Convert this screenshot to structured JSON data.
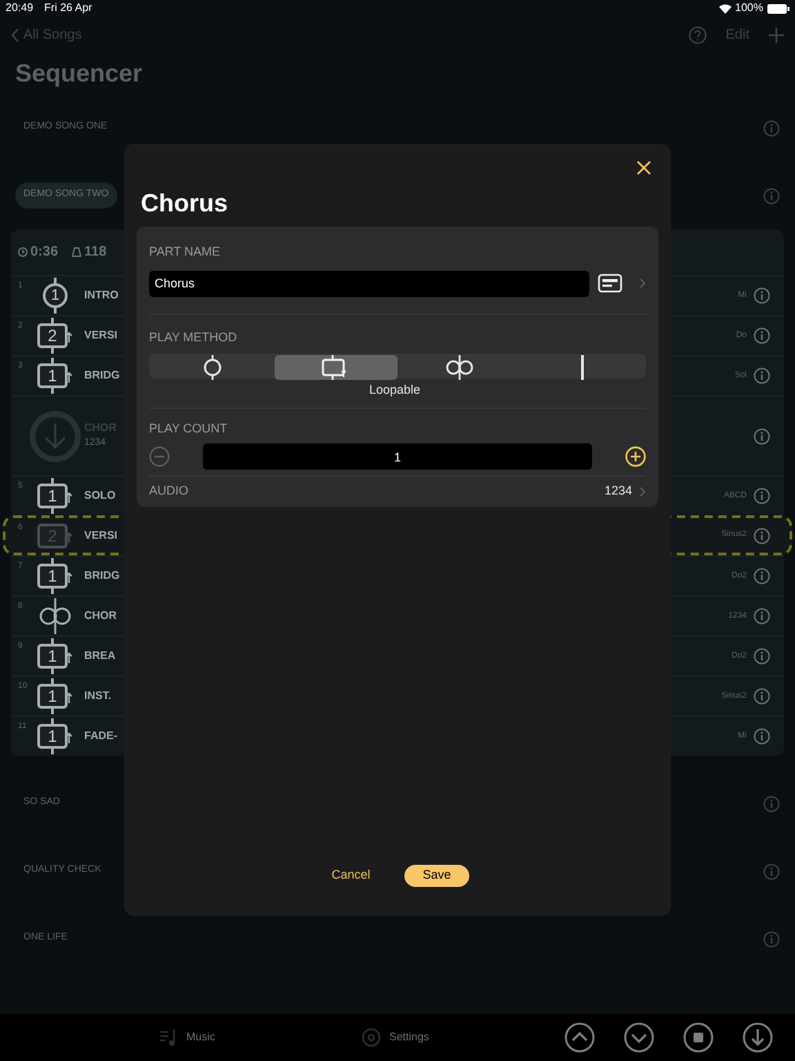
{
  "status_bar": {
    "time": "20:49",
    "date": "Fri 26 Apr",
    "battery": "100%"
  },
  "nav": {
    "back": "All Songs",
    "edit": "Edit"
  },
  "title": "Sequencer",
  "songs_before": [
    {
      "name": "DEMO SONG ONE",
      "selected": false
    },
    {
      "name": "DEMO SONG TWO",
      "selected": true
    }
  ],
  "song_header": {
    "duration": "0:36",
    "tempo": "118"
  },
  "parts": [
    {
      "number": "1",
      "kind": "once",
      "count": "1",
      "name": "INTRO",
      "key": "Mi",
      "dragging": false
    },
    {
      "number": "2",
      "kind": "loop",
      "count": "2",
      "name": "VERSI",
      "key": "Do",
      "dragging": false
    },
    {
      "number": "3",
      "kind": "loop",
      "count": "1",
      "name": "BRIDG",
      "key": "Sol",
      "dragging": false
    },
    {
      "kind": "download",
      "name": "CHOR",
      "audio": "1234",
      "dragging": false
    },
    {
      "number": "5",
      "kind": "loop",
      "count": "1",
      "name": "SOLO",
      "key": "ABCD",
      "dragging": false
    },
    {
      "number": "6",
      "kind": "loop",
      "count": "2",
      "name": "VERSI",
      "key": "Sinus2",
      "dragging": true
    },
    {
      "number": "7",
      "kind": "loop",
      "count": "1",
      "name": "BRIDG",
      "key": "Do2",
      "dragging": false
    },
    {
      "number": "8",
      "kind": "infinite",
      "name": "CHOR",
      "key": "1234",
      "dragging": false
    },
    {
      "number": "9",
      "kind": "loop",
      "count": "1",
      "name": "BREA",
      "key": "Do2",
      "dragging": false
    },
    {
      "number": "10",
      "kind": "loop",
      "count": "1",
      "name": "INST.",
      "key": "Sinus2",
      "dragging": false
    },
    {
      "number": "11",
      "kind": "loop",
      "count": "1",
      "name": "FADE-",
      "key": "Mi",
      "dragging": false
    }
  ],
  "songs_after": [
    {
      "name": "SO SAD"
    },
    {
      "name": "QUALITY CHECK"
    },
    {
      "name": "ONE LIFE"
    }
  ],
  "tab_bar": [
    {
      "label": "Music",
      "kind": "music"
    },
    {
      "label": "Settings",
      "kind": "settings"
    }
  ],
  "transport": [
    {
      "kind": "up"
    },
    {
      "kind": "down"
    },
    {
      "kind": "stop"
    },
    {
      "kind": "download"
    }
  ],
  "dialog": {
    "title": "Chorus",
    "part_name": {
      "label": "PART NAME",
      "value": "Chorus"
    },
    "play_method": {
      "label": "PLAY METHOD",
      "options": [
        {
          "kind": "once",
          "selected": false
        },
        {
          "kind": "loop",
          "selected": true
        },
        {
          "kind": "infinite",
          "selected": false
        },
        {
          "kind": "bar",
          "selected": false
        }
      ],
      "caption": "Loopable"
    },
    "play_count": {
      "label": "PLAY COUNT",
      "value": "1"
    },
    "audio": {
      "label": "AUDIO",
      "value": "1234"
    },
    "buttons": [
      {
        "label": "Cancel",
        "kind": "text"
      },
      {
        "label": "Save",
        "kind": "primary"
      }
    ]
  }
}
